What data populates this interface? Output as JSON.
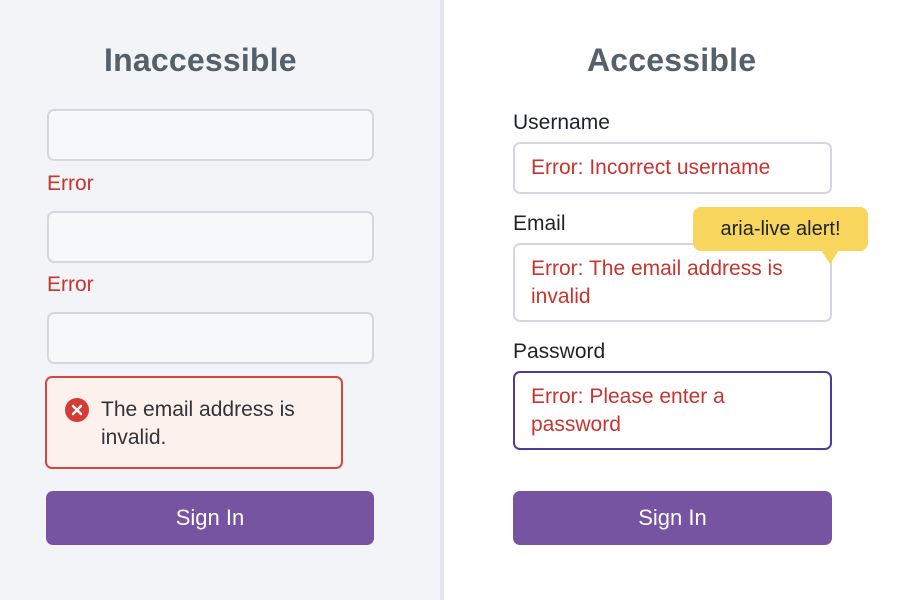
{
  "left": {
    "title": "Inaccessible",
    "inline_errors": [
      "Error",
      "Error"
    ],
    "error_box": {
      "icon": "error-circle-x-icon",
      "message": "The email address is invalid."
    },
    "sign_in_label": "Sign In"
  },
  "right": {
    "title": "Accessible",
    "fields": {
      "username": {
        "label": "Username",
        "value": "Error: Incorrect username"
      },
      "email": {
        "label": "Email",
        "value": "Error: The email address is invalid"
      },
      "password": {
        "label": "Password",
        "value": "Error: Please enter a password"
      }
    },
    "tooltip": "aria-live alert!",
    "sign_in_label": "Sign In"
  },
  "colors": {
    "error_red": "#c8342e",
    "button_purple": "#7654a2",
    "focus_border": "#4b3c9e",
    "tooltip_yellow": "#f8d55c",
    "title_gray": "#56606b"
  }
}
